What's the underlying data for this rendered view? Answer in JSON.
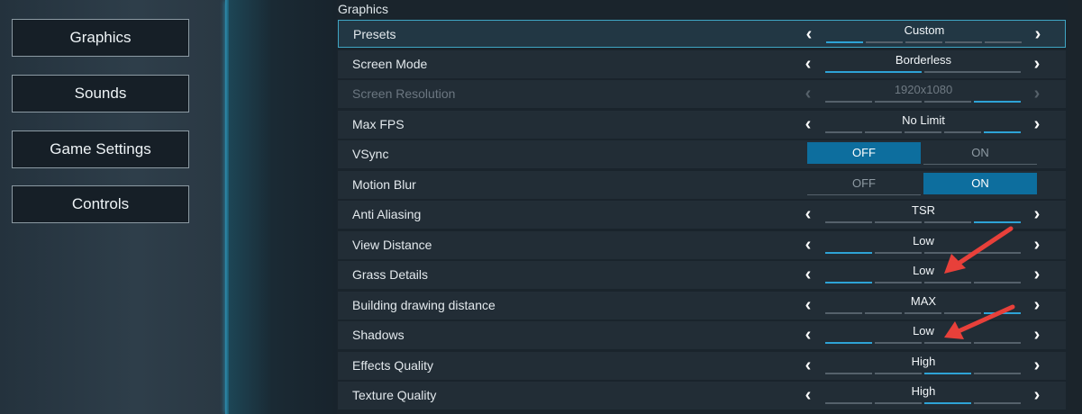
{
  "nav": {
    "items": [
      {
        "label": "Graphics"
      },
      {
        "label": "Sounds"
      },
      {
        "label": "Game Settings"
      },
      {
        "label": "Controls"
      }
    ]
  },
  "section_title": "Graphics",
  "settings": [
    {
      "label": "Presets",
      "value": "Custom",
      "type": "selector",
      "segments": 5,
      "active_segment": 0,
      "state": "active"
    },
    {
      "label": "Screen Mode",
      "value": "Borderless",
      "type": "selector",
      "segments": 2,
      "active_segment": 0,
      "state": "normal"
    },
    {
      "label": "Screen Resolution",
      "value": "1920x1080",
      "type": "selector",
      "segments": 4,
      "active_segment": 3,
      "state": "disabled"
    },
    {
      "label": "Max FPS",
      "value": "No Limit",
      "type": "selector",
      "segments": 5,
      "active_segment": 4,
      "state": "normal"
    },
    {
      "label": "VSync",
      "type": "toggle",
      "off_label": "OFF",
      "on_label": "ON",
      "selected": "OFF",
      "state": "normal"
    },
    {
      "label": "Motion Blur",
      "type": "toggle",
      "off_label": "OFF",
      "on_label": "ON",
      "selected": "ON",
      "state": "normal"
    },
    {
      "label": "Anti Aliasing",
      "value": "TSR",
      "type": "selector",
      "segments": 4,
      "active_segment": 3,
      "state": "normal"
    },
    {
      "label": "View Distance",
      "value": "Low",
      "type": "selector",
      "segments": 4,
      "active_segment": 0,
      "state": "normal"
    },
    {
      "label": "Grass Details",
      "value": "Low",
      "type": "selector",
      "segments": 4,
      "active_segment": 0,
      "state": "normal"
    },
    {
      "label": "Building drawing distance",
      "value": "MAX",
      "type": "selector",
      "segments": 5,
      "active_segment": 4,
      "state": "normal"
    },
    {
      "label": "Shadows",
      "value": "Low",
      "type": "selector",
      "segments": 4,
      "active_segment": 0,
      "state": "normal"
    },
    {
      "label": "Effects Quality",
      "value": "High",
      "type": "selector",
      "segments": 4,
      "active_segment": 2,
      "state": "normal"
    },
    {
      "label": "Texture Quality",
      "value": "High",
      "type": "selector",
      "segments": 4,
      "active_segment": 2,
      "state": "normal"
    }
  ],
  "icons": {
    "left": "chevron-left-icon",
    "right": "chevron-right-icon"
  },
  "colors": {
    "accent": "#2ea3d6",
    "selected_toggle": "#0d6e9e",
    "annotation_arrow": "#e8403a"
  }
}
